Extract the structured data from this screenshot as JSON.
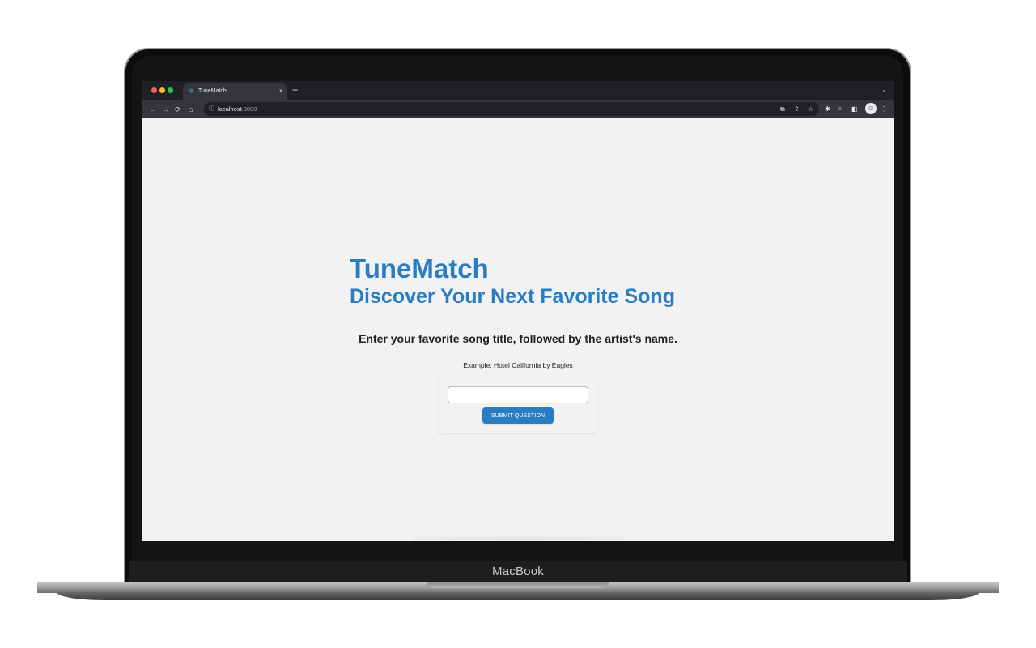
{
  "device": {
    "brand_label": "MacBook"
  },
  "browser": {
    "tab": {
      "title": "TuneMatch",
      "icon": "react-atom-icon"
    },
    "new_tab_symbol": "+",
    "close_symbol": "×",
    "tab_menu_symbol": "⌄",
    "url_host": "localhost",
    "url_port": ":3000",
    "nav_icons": {
      "back": "←",
      "forward": "→",
      "reload": "C",
      "home": "⌂",
      "info": "ⓘ"
    },
    "toolbar_icons": [
      "open-in-icon",
      "share-icon",
      "star-icon",
      "extensions-icon",
      "reading-list-icon",
      "side-panel-icon",
      "profile-avatar-icon",
      "more-menu-icon"
    ]
  },
  "app": {
    "title": "TuneMatch",
    "subtitle": "Discover Your Next Favorite Song",
    "prompt": "Enter your favorite song title, followed by the artist's name.",
    "example": "Example: Hotel California by Eagles",
    "input": {
      "value": "",
      "placeholder": ""
    },
    "submit_label": "SUBMIT QUESTION"
  },
  "colors": {
    "accent": "#2a7dc2",
    "page_bg": "#f2f2f2",
    "chrome_dark": "#202124",
    "chrome_toolbar": "#35363a"
  }
}
